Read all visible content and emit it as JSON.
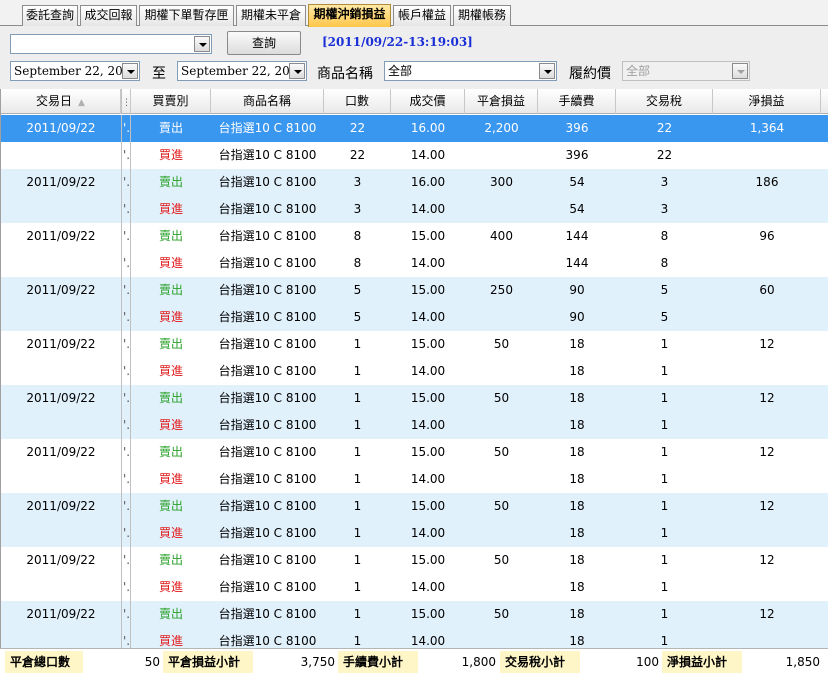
{
  "tabs": [
    {
      "label": "委託查詢",
      "active": false
    },
    {
      "label": "成交回報",
      "active": false
    },
    {
      "label": "期權下單暫存匣",
      "active": false
    },
    {
      "label": "期權未平倉",
      "active": false
    },
    {
      "label": "期權沖銷損益",
      "active": true
    },
    {
      "label": "帳戶權益",
      "active": false
    },
    {
      "label": "期權帳務",
      "active": false
    }
  ],
  "toolbar": {
    "account_value": "",
    "query_label": "查詢",
    "timestamp": "[2011/09/22-13:19:03]",
    "date_from": "September 22, 2011",
    "to_label": "至",
    "date_to": "September 22, 2011",
    "product_label": "商品名稱",
    "product_value": "全部",
    "strike_label": "履約價",
    "strike_value": "全部"
  },
  "table": {
    "columns": [
      "交易日",
      "",
      "買賣別",
      "商品名稱",
      "口數",
      "成交價",
      "平倉損益",
      "手續費",
      "交易稅",
      "淨損益"
    ],
    "rows": [
      [
        "2011/09/22",
        "'.",
        "賣出",
        "台指選10 C 8100",
        "22",
        "16.00",
        "2,200",
        "396",
        "22",
        "1,364"
      ],
      [
        "",
        "'.",
        "買進",
        "台指選10 C 8100",
        "22",
        "14.00",
        "",
        "396",
        "22",
        ""
      ],
      [
        "2011/09/22",
        "'.",
        "賣出",
        "台指選10 C 8100",
        "3",
        "16.00",
        "300",
        "54",
        "3",
        "186"
      ],
      [
        "",
        "'.",
        "買進",
        "台指選10 C 8100",
        "3",
        "14.00",
        "",
        "54",
        "3",
        ""
      ],
      [
        "2011/09/22",
        "'.",
        "賣出",
        "台指選10 C 8100",
        "8",
        "15.00",
        "400",
        "144",
        "8",
        "96"
      ],
      [
        "",
        "'.",
        "買進",
        "台指選10 C 8100",
        "8",
        "14.00",
        "",
        "144",
        "8",
        ""
      ],
      [
        "2011/09/22",
        "'.",
        "賣出",
        "台指選10 C 8100",
        "5",
        "15.00",
        "250",
        "90",
        "5",
        "60"
      ],
      [
        "",
        "'.",
        "買進",
        "台指選10 C 8100",
        "5",
        "14.00",
        "",
        "90",
        "5",
        ""
      ],
      [
        "2011/09/22",
        "'.",
        "賣出",
        "台指選10 C 8100",
        "1",
        "15.00",
        "50",
        "18",
        "1",
        "12"
      ],
      [
        "",
        "'.",
        "買進",
        "台指選10 C 8100",
        "1",
        "14.00",
        "",
        "18",
        "1",
        ""
      ],
      [
        "2011/09/22",
        "'.",
        "賣出",
        "台指選10 C 8100",
        "1",
        "15.00",
        "50",
        "18",
        "1",
        "12"
      ],
      [
        "",
        "'.",
        "買進",
        "台指選10 C 8100",
        "1",
        "14.00",
        "",
        "18",
        "1",
        ""
      ],
      [
        "2011/09/22",
        "'.",
        "賣出",
        "台指選10 C 8100",
        "1",
        "15.00",
        "50",
        "18",
        "1",
        "12"
      ],
      [
        "",
        "'.",
        "買進",
        "台指選10 C 8100",
        "1",
        "14.00",
        "",
        "18",
        "1",
        ""
      ],
      [
        "2011/09/22",
        "'.",
        "賣出",
        "台指選10 C 8100",
        "1",
        "15.00",
        "50",
        "18",
        "1",
        "12"
      ],
      [
        "",
        "'.",
        "買進",
        "台指選10 C 8100",
        "1",
        "14.00",
        "",
        "18",
        "1",
        ""
      ],
      [
        "2011/09/22",
        "'.",
        "賣出",
        "台指選10 C 8100",
        "1",
        "15.00",
        "50",
        "18",
        "1",
        "12"
      ],
      [
        "",
        "'.",
        "買進",
        "台指選10 C 8100",
        "1",
        "14.00",
        "",
        "18",
        "1",
        ""
      ],
      [
        "2011/09/22",
        "'.",
        "賣出",
        "台指選10 C 8100",
        "1",
        "15.00",
        "50",
        "18",
        "1",
        "12"
      ],
      [
        "",
        "'.",
        "買進",
        "台指選10 C 8100",
        "1",
        "14.00",
        "",
        "18",
        "1",
        ""
      ]
    ]
  },
  "footer": {
    "total_lots_label": "平倉總口數",
    "total_lots": "50",
    "pnl_label": "平倉損益小計",
    "pnl": "3,750",
    "fee_label": "手續費小計",
    "fee": "1,800",
    "tax_label": "交易稅小計",
    "tax": "100",
    "net_label": "淨損益小計",
    "net": "1,850"
  },
  "colors": {
    "selected_row": "#3a97f0",
    "alt_row": "#e1f1fc",
    "sell_text": "#2aa12a",
    "buy_text": "#e21c1c",
    "timestamp": "#1a2fd6",
    "active_tab": "#ffc64a",
    "footer_label_bg": "#fff6c8"
  },
  "icons": [
    "dropdown-arrow-icon",
    "sort-ascending-icon"
  ]
}
